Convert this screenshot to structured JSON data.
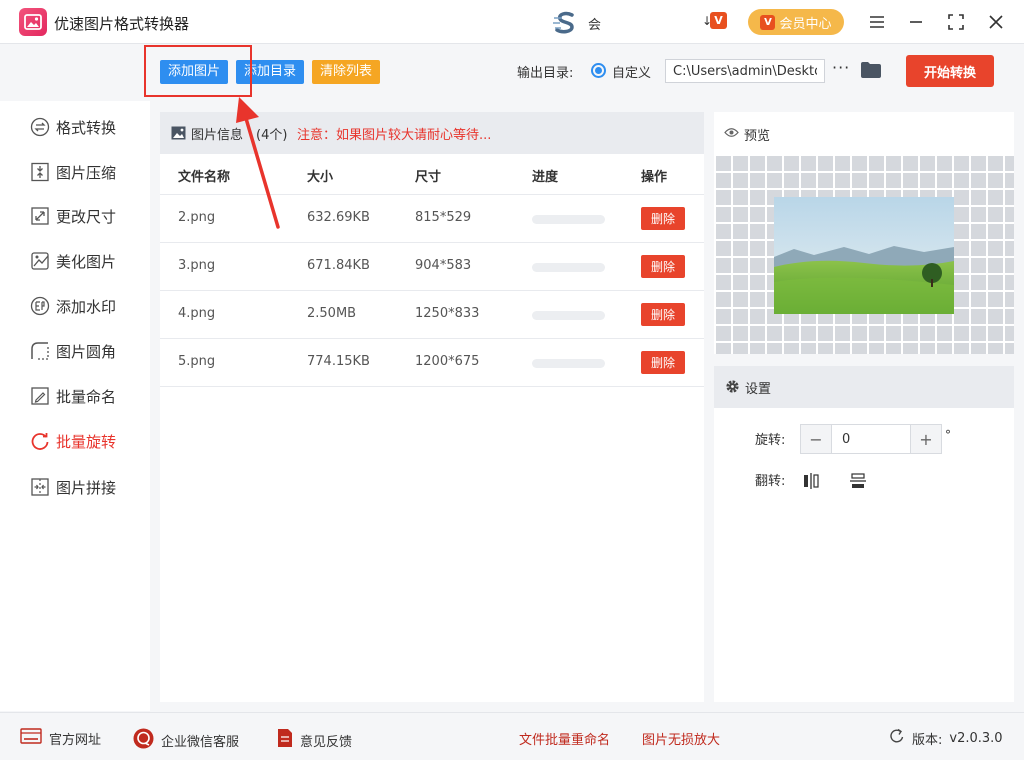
{
  "app": {
    "title": "优速图片格式转换器",
    "promo_text": "会",
    "promo_arrow": "↓",
    "vip_label": "会员中心",
    "vip_badge": "V"
  },
  "toolbar": {
    "add_image": "添加图片",
    "add_folder": "添加目录",
    "clear_list": "清除列表",
    "output_label": "输出目录:",
    "radio_label": "自定义",
    "output_path": "C:\\Users\\admin\\Desktop",
    "more": "···",
    "start": "开始转换"
  },
  "sidebar": {
    "items": [
      {
        "label": "格式转换",
        "icon": "convert-icon"
      },
      {
        "label": "图片压缩",
        "icon": "compress-icon"
      },
      {
        "label": "更改尺寸",
        "icon": "resize-icon"
      },
      {
        "label": "美化图片",
        "icon": "beautify-icon"
      },
      {
        "label": "添加水印",
        "icon": "watermark-icon"
      },
      {
        "label": "图片圆角",
        "icon": "round-corner-icon"
      },
      {
        "label": "批量命名",
        "icon": "rename-icon"
      },
      {
        "label": "批量旋转",
        "icon": "rotate-icon",
        "active": true
      },
      {
        "label": "图片拼接",
        "icon": "stitch-icon"
      }
    ]
  },
  "file_list": {
    "title": "图片信息",
    "count": "(4个)",
    "note": "注意：如果图片较大请耐心等待...",
    "columns": [
      "文件名称",
      "大小",
      "尺寸",
      "进度",
      "操作"
    ],
    "rows": [
      {
        "name": "2.png",
        "size": "632.69KB",
        "dims": "815*529",
        "progress": 0,
        "action": "删除"
      },
      {
        "name": "3.png",
        "size": "671.84KB",
        "dims": "904*583",
        "progress": 0,
        "action": "删除"
      },
      {
        "name": "4.png",
        "size": "2.50MB",
        "dims": "1250*833",
        "progress": 0,
        "action": "删除"
      },
      {
        "name": "5.png",
        "size": "774.15KB",
        "dims": "1200*675",
        "progress": 0,
        "action": "删除"
      }
    ]
  },
  "preview": {
    "title": "预览"
  },
  "settings": {
    "title": "设置",
    "rotate_label": "旋转:",
    "rotate_value": "0",
    "rotate_unit": "°",
    "minus": "−",
    "plus": "+",
    "flip_label": "翻转:"
  },
  "footer": {
    "website": "官方网址",
    "wechat": "企业微信客服",
    "feedback": "意见反馈",
    "link1": "文件批量重命名",
    "link2": "图片无损放大",
    "version_label": "版本:",
    "version": "v2.0.3.0"
  },
  "colors": {
    "accent_blue": "#2e8ef0",
    "accent_red": "#e8442c",
    "accent_orange": "#f5a623",
    "vip_gold": "#f5b84a"
  }
}
